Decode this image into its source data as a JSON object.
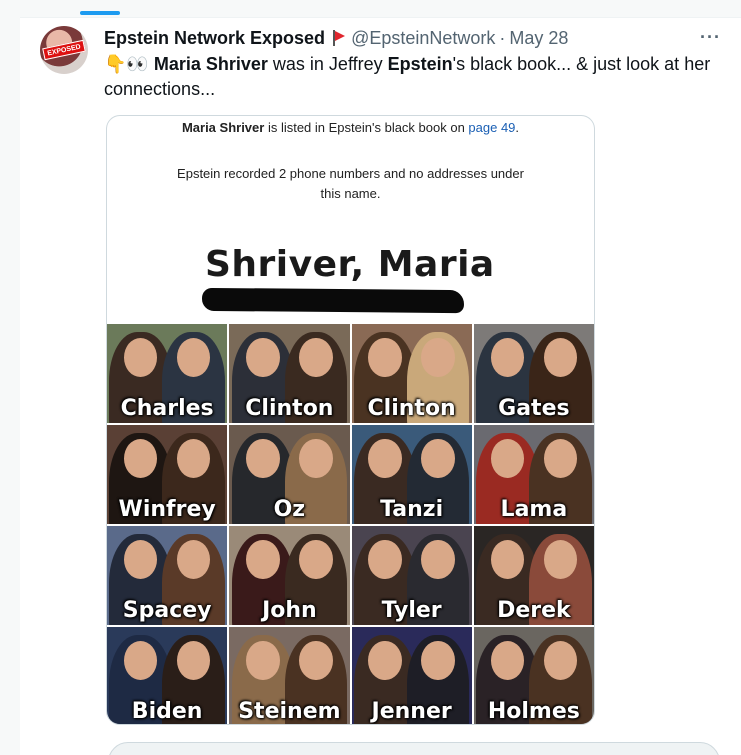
{
  "tweet": {
    "author_name": "Epstein Network Exposed",
    "handle": "@EpsteinNetwork",
    "separator": "·",
    "date": "May 28",
    "more_glyph": "···",
    "avatar_stamp": "EXPOSED",
    "text": {
      "emoji": "👇👀",
      "bold_name": "Maria Shriver",
      "mid": " was in Jeffrey ",
      "bold_epstein": "Epstein",
      "end": "'s black book... & just look at her connections..."
    }
  },
  "media": {
    "note1_name": "Maria Shriver",
    "note1_text": " is listed in Epstein's black book on ",
    "note1_link": "page 49",
    "note1_end": ".",
    "note2": "Epstein recorded 2 phone numbers and no addresses under this name.",
    "book_entry": "Shriver, Maria",
    "cells": [
      {
        "label": "Charles",
        "bg": "#6b7a5a",
        "c1": "#3a2a22",
        "c2": "#2b3442"
      },
      {
        "label": "Clinton",
        "bg": "#7a6a58",
        "c1": "#2c2f38",
        "c2": "#3a2a20"
      },
      {
        "label": "Clinton",
        "bg": "#8a6a55",
        "c1": "#4a3322",
        "c2": "#c9a87a"
      },
      {
        "label": "Gates",
        "bg": "#7d7a78",
        "c1": "#2b3440",
        "c2": "#3a2518"
      },
      {
        "label": "Winfrey",
        "bg": "#5a4035",
        "c1": "#1e1612",
        "c2": "#3c281c"
      },
      {
        "label": "Oz",
        "bg": "#6a5a4e",
        "c1": "#26282c",
        "c2": "#8a6a4a"
      },
      {
        "label": "Tanzi",
        "bg": "#3a5a7a",
        "c1": "#3a2a22",
        "c2": "#232a34"
      },
      {
        "label": "Lama",
        "bg": "#6a6a70",
        "c1": "#9a2a22",
        "c2": "#4a3222"
      },
      {
        "label": "Spacey",
        "bg": "#5a6a8a",
        "c1": "#232a3a",
        "c2": "#5a3a28"
      },
      {
        "label": "John",
        "bg": "#9a8a78",
        "c1": "#3a1a1a",
        "c2": "#3a2a20"
      },
      {
        "label": "Tyler",
        "bg": "#4a4450",
        "c1": "#3a2a22",
        "c2": "#2a2a30"
      },
      {
        "label": "Derek",
        "bg": "#2a2624",
        "c1": "#3a2a22",
        "c2": "#8a4a3a"
      },
      {
        "label": "Biden",
        "bg": "#2a3a5a",
        "c1": "#1e2a44",
        "c2": "#2a1e18"
      },
      {
        "label": "Steinem",
        "bg": "#7a6a62",
        "c1": "#8a6a4a",
        "c2": "#4a3222"
      },
      {
        "label": "Jenner",
        "bg": "#2a2a5a",
        "c1": "#3a2a22",
        "c2": "#1e1e26"
      },
      {
        "label": "Holmes",
        "bg": "#6a6660",
        "c1": "#2a2226",
        "c2": "#4a3222"
      }
    ]
  },
  "colors": {
    "accent": "#1d9bf0",
    "flag": "#e0262e",
    "link": "#1a5fb4"
  }
}
